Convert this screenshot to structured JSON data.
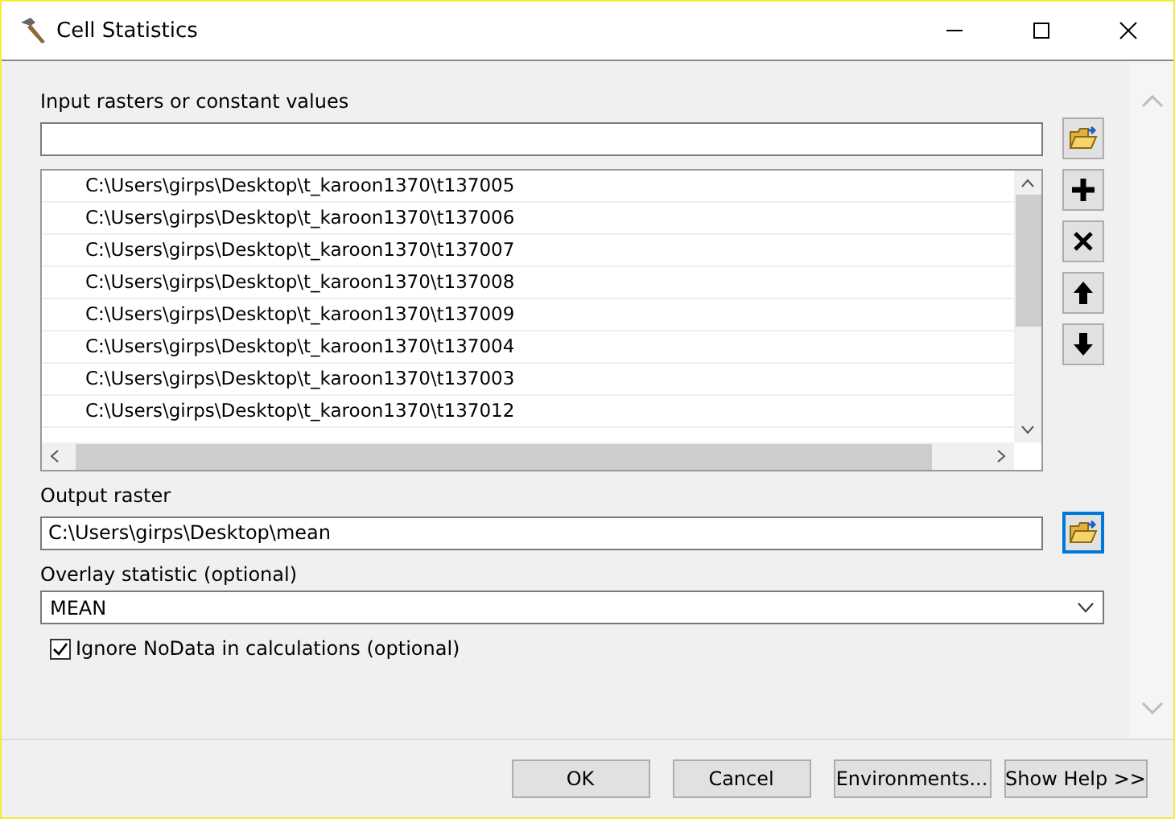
{
  "window": {
    "title": "Cell Statistics"
  },
  "input": {
    "label": "Input rasters or constant values"
  },
  "rasters": [
    "C:\\Users\\girps\\Desktop\\t_karoon1370\\t137005",
    "C:\\Users\\girps\\Desktop\\t_karoon1370\\t137006",
    "C:\\Users\\girps\\Desktop\\t_karoon1370\\t137007",
    "C:\\Users\\girps\\Desktop\\t_karoon1370\\t137008",
    "C:\\Users\\girps\\Desktop\\t_karoon1370\\t137009",
    "C:\\Users\\girps\\Desktop\\t_karoon1370\\t137004",
    "C:\\Users\\girps\\Desktop\\t_karoon1370\\t137003",
    "C:\\Users\\girps\\Desktop\\t_karoon1370\\t137012"
  ],
  "output": {
    "label": "Output raster",
    "value": "C:\\Users\\girps\\Desktop\\mean"
  },
  "statistic": {
    "label": "Overlay statistic (optional)",
    "value": "MEAN"
  },
  "ignore_nodata": {
    "label": "Ignore NoData in calculations (optional)",
    "checked": true
  },
  "buttons": [
    "OK",
    "Cancel",
    "Environments...",
    "Show Help >>"
  ]
}
